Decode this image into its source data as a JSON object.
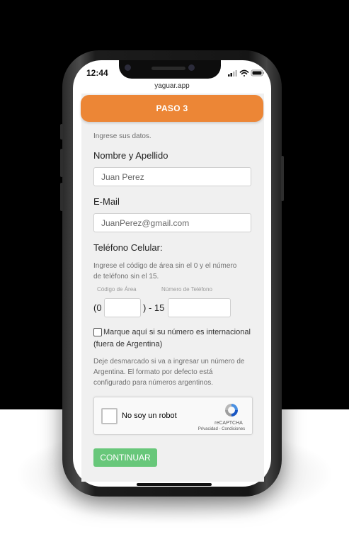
{
  "status": {
    "time": "12:44"
  },
  "browser": {
    "url": "yaguar.app"
  },
  "form": {
    "step": "PASO 3",
    "intro": "Ingrese sus datos.",
    "name_label": "Nombre y Apellido",
    "name_value": "Juan Perez",
    "email_label": "E-Mail",
    "email_value": "JuanPerez@gmail.com",
    "phone_label": "Teléfono Celular:",
    "phone_help_1": "Ingrese el código de área sin el 0 y el número",
    "phone_help_2": "de teléfono sin el 15.",
    "area_code_caption": "Código de Área",
    "phone_number_caption": "Número de Teléfono",
    "prefix_open": "(0",
    "prefix_mid": ") - 15",
    "intl_label_1": "Marque aquí si su número es internacional",
    "intl_label_2": "(fuera de Argentina)",
    "intl_help_1": "Deje desmarcado si va a ingresar un número de",
    "intl_help_2": "Argentina. El formato por defecto está",
    "intl_help_3": "configurado para números argentinos.",
    "continue_label": "CONTINUAR"
  },
  "recaptcha": {
    "label": "No soy un robot",
    "brand": "reCAPTCHA",
    "links": "Privacidad - Condiciones"
  },
  "colors": {
    "accent": "#ec8636",
    "button": "#68c77a"
  }
}
